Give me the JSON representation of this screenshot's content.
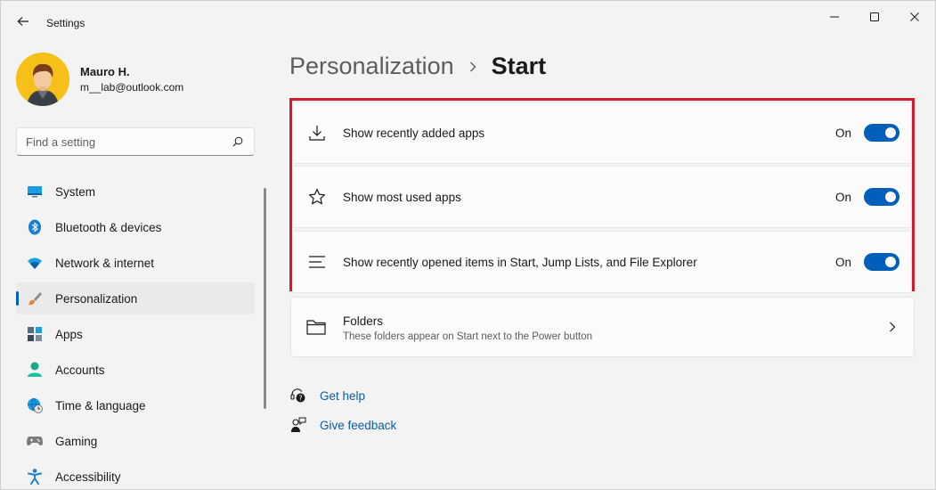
{
  "window": {
    "title": "Settings"
  },
  "profile": {
    "name": "Mauro H.",
    "email": "m__lab@outlook.com"
  },
  "search": {
    "placeholder": "Find a setting",
    "value": ""
  },
  "sidebar": {
    "items": [
      {
        "label": "System",
        "icon": "system-icon"
      },
      {
        "label": "Bluetooth & devices",
        "icon": "bluetooth-icon"
      },
      {
        "label": "Network & internet",
        "icon": "wifi-icon"
      },
      {
        "label": "Personalization",
        "icon": "brush-icon",
        "active": true
      },
      {
        "label": "Apps",
        "icon": "apps-icon"
      },
      {
        "label": "Accounts",
        "icon": "accounts-icon"
      },
      {
        "label": "Time & language",
        "icon": "globe-clock-icon"
      },
      {
        "label": "Gaming",
        "icon": "gamepad-icon"
      },
      {
        "label": "Accessibility",
        "icon": "accessibility-icon"
      }
    ]
  },
  "breadcrumb": {
    "parent": "Personalization",
    "current": "Start"
  },
  "settings": [
    {
      "label": "Show recently added apps",
      "state": "On",
      "icon": "download-icon"
    },
    {
      "label": "Show most used apps",
      "state": "On",
      "icon": "star-icon"
    },
    {
      "label": "Show recently opened items in Start, Jump Lists, and File Explorer",
      "state": "On",
      "icon": "list-icon"
    }
  ],
  "folders": {
    "title": "Folders",
    "subtitle": "These folders appear on Start next to the Power button",
    "icon": "folder-icon"
  },
  "links": {
    "help": "Get help",
    "feedback": "Give feedback"
  },
  "colors": {
    "accent": "#005fb8",
    "highlight_border": "#d01c2a",
    "link": "#0a5da8"
  }
}
